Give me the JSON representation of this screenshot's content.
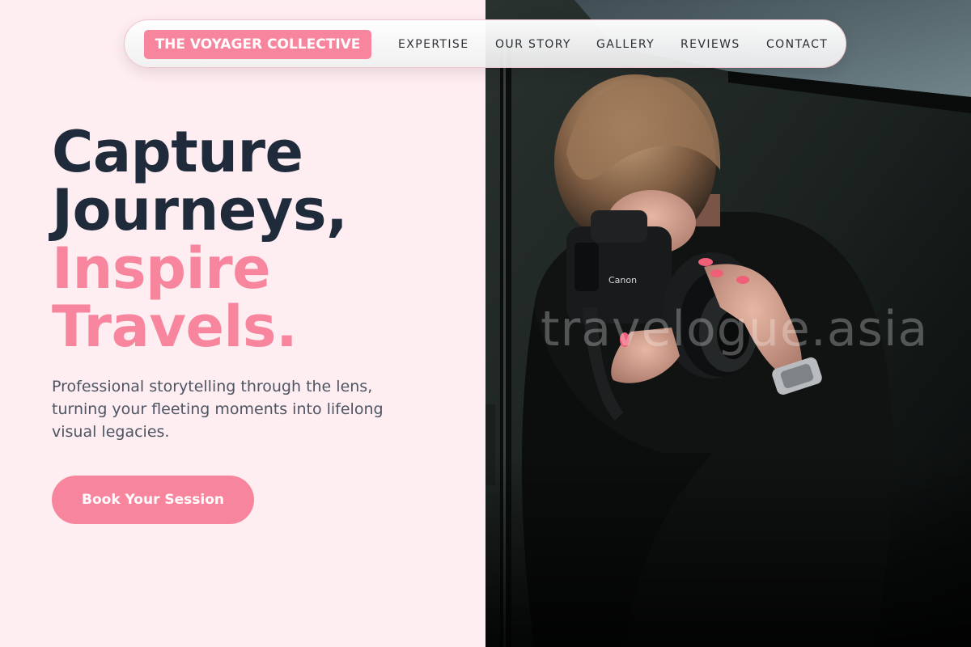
{
  "nav": {
    "brand": "THE VOYAGER COLLECTIVE",
    "links": [
      "EXPERTISE",
      "OUR STORY",
      "GALLERY",
      "REVIEWS",
      "CONTACT"
    ]
  },
  "hero": {
    "title_lines": [
      "Capture",
      "Journeys,"
    ],
    "accent_lines": [
      "Inspire",
      "Travels."
    ],
    "subtitle": "Professional storytelling through the lens, turning your fleeting moments into lifelong visual legacies.",
    "cta_label": "Book Your Session"
  },
  "photo": {
    "watermark": "travelogue.asia",
    "camera_brand": "Canon"
  },
  "colors": {
    "accent": "#f7859d",
    "heading": "#1f2a3b",
    "background": "#feedf1",
    "body_text": "#4d5563"
  }
}
